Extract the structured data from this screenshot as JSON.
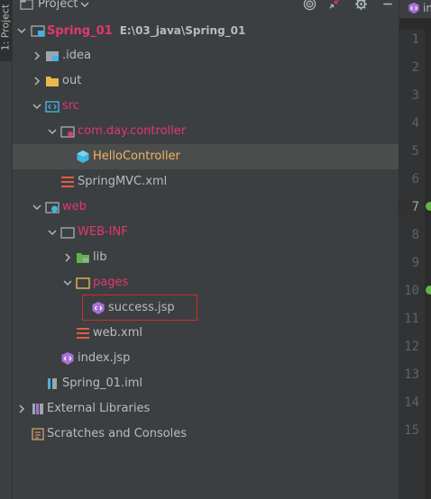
{
  "sidebar_strip": {
    "label": "1: Project"
  },
  "toolbar": {
    "title": "Project"
  },
  "tree": [
    {
      "label": "Spring_01",
      "sub": "E:\\03_java\\Spring_01",
      "color": "red",
      "icon": "module-folder-icon",
      "expanded": true
    },
    {
      "label": ".idea",
      "color": "default",
      "icon": "idea-folder-icon",
      "expanded": false
    },
    {
      "label": "out",
      "color": "default",
      "icon": "folder-icon",
      "expanded": false
    },
    {
      "label": "src",
      "color": "red",
      "icon": "source-folder-icon",
      "expanded": true
    },
    {
      "label": "com.day.controller",
      "color": "red",
      "icon": "package-icon",
      "expanded": true
    },
    {
      "label": "HelloController",
      "color": "orange",
      "icon": "class-icon",
      "selected": true
    },
    {
      "label": "SpringMVC.xml",
      "color": "default",
      "icon": "xml-file-icon"
    },
    {
      "label": "web",
      "color": "red",
      "icon": "web-folder-icon",
      "expanded": true
    },
    {
      "label": "WEB-INF",
      "color": "red",
      "icon": "folder-icon",
      "expanded": true
    },
    {
      "label": "lib",
      "color": "default",
      "icon": "library-folder-icon",
      "expanded": false
    },
    {
      "label": "pages",
      "color": "red",
      "icon": "folder-icon",
      "expanded": true
    },
    {
      "label": "success.jsp",
      "color": "default",
      "icon": "jsp-file-icon",
      "highlighted": true
    },
    {
      "label": "web.xml",
      "color": "default",
      "icon": "xml-file-icon"
    },
    {
      "label": "index.jsp",
      "color": "default",
      "icon": "jsp-file-icon"
    },
    {
      "label": "Spring_01.iml",
      "color": "default",
      "icon": "iml-file-icon"
    },
    {
      "label": "External Libraries",
      "color": "default",
      "icon": "libraries-icon",
      "expanded": false
    },
    {
      "label": "Scratches and Consoles",
      "color": "default",
      "icon": "scratches-icon"
    }
  ],
  "editor": {
    "tab_label": "in",
    "line_numbers": [
      "1",
      "2",
      "3",
      "4",
      "5",
      "6",
      "7",
      "8",
      "9",
      "10",
      "11",
      "12",
      "13",
      "14",
      "15"
    ],
    "active_line": "7"
  },
  "colors": {
    "panel_bg": "#3c3f41",
    "editor_bg": "#2b2b2b",
    "red_text": "#e3376b",
    "orange_text": "#f0b35f",
    "selection_bg": "#4b4d4d",
    "highlight_border": "#d02b2b"
  }
}
